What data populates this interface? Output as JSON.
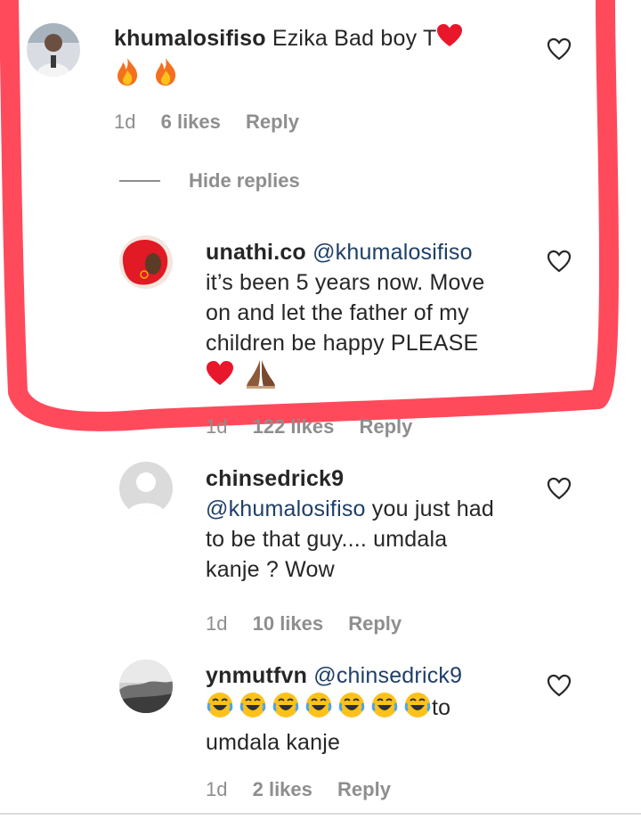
{
  "comments": [
    {
      "username": "khumalosifiso",
      "mention": "",
      "text": "Ezika Bad boy T",
      "emoji_inline": "heart",
      "emoji_line": [
        "fire",
        "fire"
      ],
      "time": "1d",
      "likes": "6 likes",
      "reply": "Reply"
    },
    {
      "username": "unathi.co",
      "mention": "@khumalosifiso",
      "line1": "it’s been 5 years now. Move",
      "line2": "on and let the father of my",
      "line3": "children be happy PLEASE",
      "emoji_line": [
        "red-heart",
        "folded-hands"
      ],
      "time": "1d",
      "likes": "122 likes",
      "reply": "Reply"
    },
    {
      "username": "chinsedrick9",
      "mention": "@khumalosifiso",
      "line1": " you just had",
      "line2": "to be that guy.... umdala",
      "line3": "kanje ? Wow",
      "time": "1d",
      "likes": "10 likes",
      "reply": "Reply"
    },
    {
      "username": "ynmutfvn",
      "mention": "@chinsedrick9",
      "emoji_line": [
        "joy",
        "joy",
        "joy",
        "joy",
        "joy",
        "joy",
        "joy"
      ],
      "line1_suffix": "to",
      "line2": "umdala kanje",
      "time": "1d",
      "likes": "2 likes",
      "reply": "Reply"
    }
  ],
  "hide_replies": "Hide replies",
  "colors": {
    "text": "#262626",
    "secondary": "#8e8e8e",
    "mention": "#1f3f68",
    "highlight": "#ff3b4e"
  }
}
